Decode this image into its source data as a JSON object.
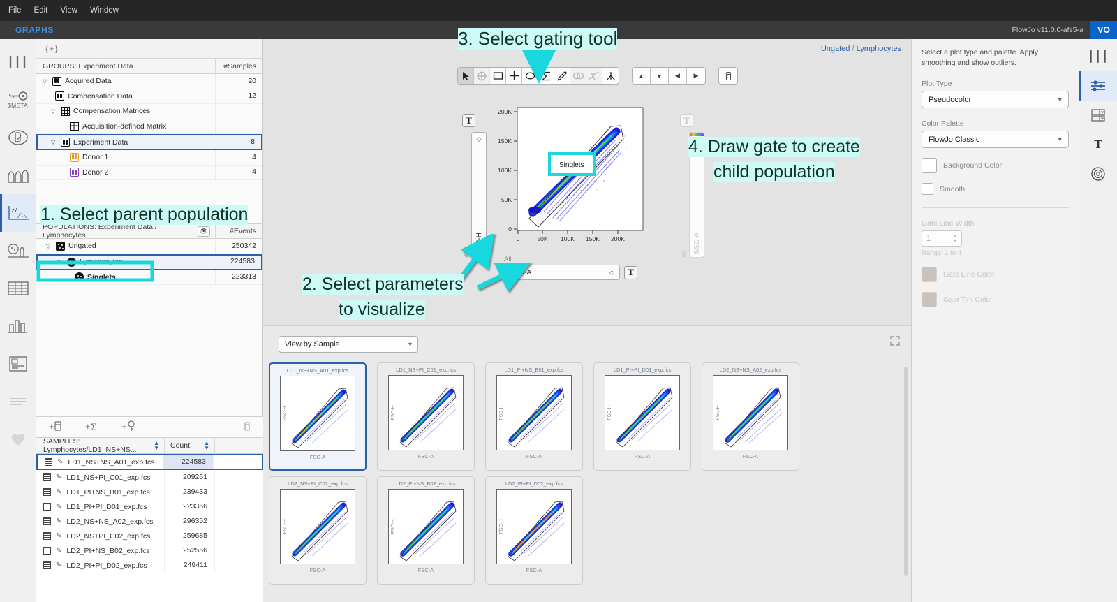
{
  "menubar": {
    "items": [
      "File",
      "Edit",
      "View",
      "Window"
    ]
  },
  "titlebar": {
    "tab": "GRAPHS",
    "version": "FlowJo v11.0.0-afs5-a",
    "avatar": "VO"
  },
  "left_rail": {
    "items": [
      {
        "name": "panels-icon",
        "label": ""
      },
      {
        "name": "meta-key-icon",
        "label": "$META"
      },
      {
        "name": "compensation-icon",
        "label": ""
      },
      {
        "name": "histogram-icon",
        "label": ""
      },
      {
        "name": "graphs-scatter-icon",
        "label": ""
      },
      {
        "name": "populations-icon",
        "label": ""
      },
      {
        "name": "table-icon",
        "label": ""
      },
      {
        "name": "bar-chart-icon",
        "label": ""
      },
      {
        "name": "layout-report-icon",
        "label": ""
      },
      {
        "name": "list-icon",
        "label": ""
      },
      {
        "name": "favorites-heart-icon",
        "label": ""
      }
    ]
  },
  "groups_panel": {
    "toolbar_label": "{+}",
    "header": {
      "title": "GROUPS: Experiment Data",
      "count_col": "#Samples"
    },
    "rows": [
      {
        "label": "Acquired Data",
        "count": "20",
        "indent": 0,
        "icon": "tube",
        "color": "dark",
        "disclosure": "open",
        "selected": false
      },
      {
        "label": "Compensation Data",
        "count": "12",
        "indent": 1,
        "icon": "tube",
        "color": "dark",
        "disclosure": "none",
        "selected": false
      },
      {
        "label": "Compensation Matrices",
        "count": "",
        "indent": 1,
        "icon": "grid",
        "color": "dark",
        "disclosure": "open",
        "selected": false
      },
      {
        "label": "Acquisition-defined Matrix",
        "count": "",
        "indent": 2,
        "icon": "grid-plain",
        "color": "dark",
        "disclosure": "none",
        "selected": false
      },
      {
        "label": "Experiment Data",
        "count": "8",
        "indent": 1,
        "icon": "tube",
        "color": "dark",
        "disclosure": "open",
        "selected": true
      },
      {
        "label": "Donor 1",
        "count": "4",
        "indent": 2,
        "icon": "tube",
        "color": "orange",
        "disclosure": "none",
        "selected": false
      },
      {
        "label": "Donor 2",
        "count": "4",
        "indent": 2,
        "icon": "tube",
        "color": "purple",
        "disclosure": "none",
        "selected": false
      }
    ]
  },
  "populations_panel": {
    "header": {
      "title": "POPULATIONS: Experiment Data / Lymphocytes",
      "count_col": "#Events",
      "eye_icon": "eye-icon"
    },
    "rows": [
      {
        "label": "Ungated",
        "count": "250342",
        "indent": 0,
        "icon": "dots",
        "disclosure": "open",
        "selected": false,
        "bold": false
      },
      {
        "label": "Lymphocytes",
        "count": "224583",
        "indent": 1,
        "icon": "circle-dots",
        "disclosure": "open",
        "selected": true,
        "bold": false
      },
      {
        "label": "Singlets",
        "count": "223313",
        "indent": 2,
        "icon": "circle-dots",
        "disclosure": "none",
        "selected": false,
        "bold": true
      }
    ]
  },
  "sample_tools": {
    "buttons": [
      "add-sample-icon",
      "add-statistic-icon",
      "add-keyword-icon"
    ],
    "trash": "trash-icon"
  },
  "samples_table": {
    "columns": [
      "SAMPLES: Lymphocytes/LD1_NS+NS...",
      "Count"
    ],
    "rows": [
      {
        "name": "LD1_NS+NS_A01_exp.fcs",
        "count": "224583",
        "selected": true
      },
      {
        "name": "LD1_NS+PI_C01_exp.fcs",
        "count": "209261",
        "selected": false
      },
      {
        "name": "LD1_PI+NS_B01_exp.fcs",
        "count": "239433",
        "selected": false
      },
      {
        "name": "LD1_PI+PI_D01_exp.fcs",
        "count": "223366",
        "selected": false
      },
      {
        "name": "LD2_NS+NS_A02_exp.fcs",
        "count": "296352",
        "selected": false
      },
      {
        "name": "LD2_NS+PI_C02_exp.fcs",
        "count": "259685",
        "selected": false
      },
      {
        "name": "LD2_PI+NS_B02_exp.fcs",
        "count": "252556",
        "selected": false
      },
      {
        "name": "LD2_PI+PI_D02_exp.fcs",
        "count": "249411",
        "selected": false
      }
    ]
  },
  "center": {
    "breadcrumb": {
      "parent": "Ungated",
      "separator": "/",
      "current": "Lymphocytes"
    },
    "gating_tools": [
      {
        "name": "pointer-tool",
        "glyph": "arrow",
        "active": true,
        "dim": false
      },
      {
        "name": "crosshair-tool",
        "glyph": "crosshair",
        "active": false,
        "dim": true
      },
      {
        "name": "rectangle-gate-tool",
        "glyph": "rect",
        "active": false,
        "dim": false
      },
      {
        "name": "quadrant-gate-tool",
        "glyph": "plus",
        "active": false,
        "dim": false
      },
      {
        "name": "ellipse-gate-tool",
        "glyph": "ellipse",
        "active": false,
        "dim": false
      },
      {
        "name": "polygon-gate-tool",
        "glyph": "polygon",
        "active": false,
        "dim": false
      },
      {
        "name": "freehand-gate-tool",
        "glyph": "pencil",
        "active": false,
        "dim": false
      },
      {
        "name": "boolean-gate-tool",
        "glyph": "venn",
        "active": false,
        "dim": true
      },
      {
        "name": "spline-gate-tool",
        "glyph": "spline",
        "active": false,
        "dim": true
      },
      {
        "name": "quadrant-split-tool",
        "glyph": "split",
        "active": false,
        "dim": false
      }
    ],
    "nav_buttons": [
      {
        "name": "nav-up-button",
        "glyph": "▲"
      },
      {
        "name": "nav-down-button",
        "glyph": "▼"
      },
      {
        "name": "nav-prev-button",
        "glyph": "◀"
      },
      {
        "name": "nav-next-button",
        "glyph": "▶"
      }
    ],
    "delete_button": "trash-icon",
    "plot": {
      "y_param": "FSC-H",
      "y_all_label": "All",
      "x_param": "FSC-A",
      "x_all_label": "All",
      "y2_param": "SSC-A",
      "y2_all_label": "All",
      "t_button": "T",
      "gate_label": "Singlets",
      "x_ticks": [
        "0",
        "50K",
        "100K",
        "150K",
        "200K"
      ],
      "y_ticks": [
        "0",
        "50K",
        "100K",
        "150K",
        "200K"
      ]
    },
    "annotations": [
      {
        "id": "a1",
        "lines": [
          "1. Select parent population"
        ]
      },
      {
        "id": "a2",
        "lines": [
          "2. Select parameters",
          "to visualize"
        ]
      },
      {
        "id": "a3",
        "lines": [
          "3. Select gating tool"
        ]
      },
      {
        "id": "a4",
        "lines": [
          "4. Draw gate to create",
          "child population"
        ]
      }
    ],
    "thumbnails": {
      "view_selector": "View by Sample",
      "expand_icon": "expand-icon",
      "axis_x": "FSC-A",
      "axis_y": "FSC-H",
      "cards": [
        {
          "name": "LD1_NS+NS_A01_exp.fcs",
          "selected": true
        },
        {
          "name": "LD1_NS+PI_C01_exp.fcs",
          "selected": false
        },
        {
          "name": "LD1_PI+NS_B01_exp.fcs",
          "selected": false
        },
        {
          "name": "LD1_PI+PI_D01_exp.fcs",
          "selected": false
        },
        {
          "name": "LD2_NS+NS_A02_exp.fcs",
          "selected": false
        },
        {
          "name": "LD2_NS+PI_C02_exp.fcs",
          "selected": false
        },
        {
          "name": "LD2_PI+NS_B02_exp.fcs",
          "selected": false
        },
        {
          "name": "LD2_PI+PI_D02_exp.fcs",
          "selected": false
        }
      ]
    }
  },
  "right_panel": {
    "description": "Select a plot type and palette. Apply smoothing and show outliers.",
    "plot_type": {
      "label": "Plot Type",
      "value": "Pseudocolor"
    },
    "color_palette": {
      "label": "Color Palette",
      "value": "FlowJo Classic"
    },
    "background_color": {
      "label": "Background Color",
      "swatch": "#ffffff"
    },
    "smooth": {
      "label": "Smooth",
      "checked": false
    },
    "gate_line_width": {
      "label": "Gate Line Width",
      "value": "1",
      "hint": "Range: 1 to 4"
    },
    "gate_line_color": {
      "label": "Gate Line Color",
      "swatch": "#c9c2bd"
    },
    "gate_tint_color": {
      "label": "Gate Tint Color",
      "swatch": "#c9c2bd"
    }
  },
  "right_rail": {
    "items": [
      {
        "name": "panels-icon",
        "selected": false
      },
      {
        "name": "sliders-settings-icon",
        "selected": true
      },
      {
        "name": "axes-ranges-icon",
        "selected": false
      },
      {
        "name": "text-format-icon",
        "selected": false
      },
      {
        "name": "color-wheel-icon",
        "selected": false
      }
    ]
  },
  "colors": {
    "accent": "#2b5fa8",
    "annotation_highlight": "#ccfaf7",
    "annotation_arrow": "#18d8de",
    "titlebar_tab": "#3b8ce0"
  }
}
